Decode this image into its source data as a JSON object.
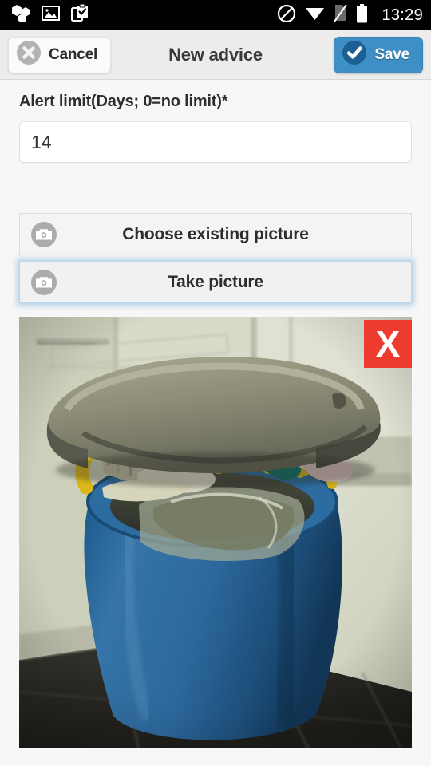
{
  "status_bar": {
    "time": "13:29",
    "left_icons": [
      {
        "name": "app-cluster-icon",
        "glyph": "hexagon-cluster"
      },
      {
        "name": "photo-icon",
        "glyph": "picture-frame"
      },
      {
        "name": "clipboard-check-icon",
        "glyph": "clipboard-check"
      }
    ],
    "right_icons": [
      {
        "name": "do-not-disturb-icon",
        "glyph": "circle-slash"
      },
      {
        "name": "wifi-icon",
        "glyph": "wifi-full"
      },
      {
        "name": "no-sim-icon",
        "glyph": "sim-slash"
      },
      {
        "name": "battery-icon",
        "glyph": "battery-full"
      }
    ],
    "background_color": "#000000",
    "foreground_color": "#ffffff"
  },
  "header": {
    "title": "New advice",
    "cancel_label": "Cancel",
    "save_label": "Save",
    "save_bg_color": "#3d8fc6",
    "cancel_bg_color": "#fbfbfb"
  },
  "form": {
    "alert_limit": {
      "label": "Alert limit(Days; 0=no limit)*",
      "value": "14",
      "placeholder": "0"
    }
  },
  "picture_actions": [
    {
      "label": "Choose existing picture",
      "focused": false
    },
    {
      "label": "Take picture",
      "focused": true
    }
  ],
  "photo_preview": {
    "alt": "Overflowing blue trash bin with lid ajar in a kitchen",
    "delete_label": "X",
    "delete_color": "#ee3b30"
  }
}
